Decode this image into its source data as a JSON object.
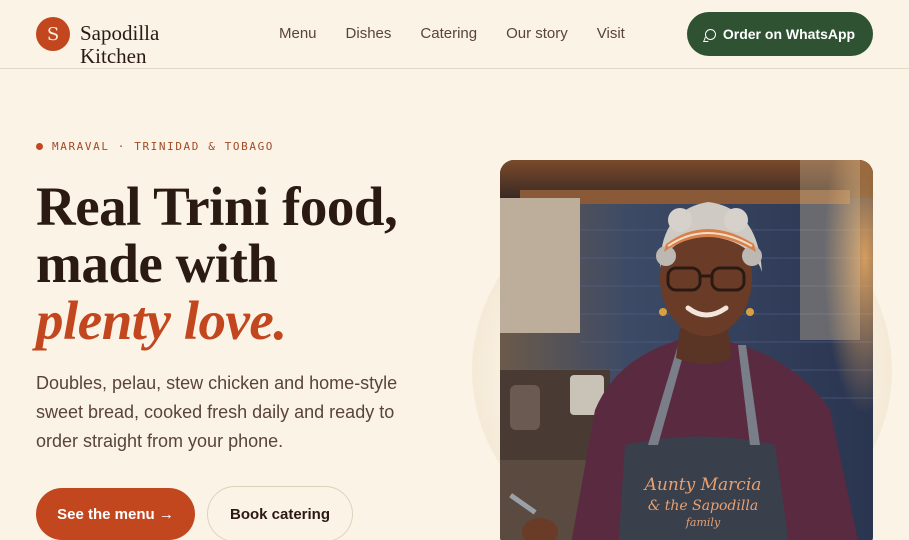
{
  "brand": {
    "initial": "S",
    "name": "Sapodilla Kitchen"
  },
  "nav": [
    {
      "label": "Menu"
    },
    {
      "label": "Dishes"
    },
    {
      "label": "Catering"
    },
    {
      "label": "Our story"
    },
    {
      "label": "Visit"
    }
  ],
  "header": {
    "order_label": "Order on WhatsApp"
  },
  "hero": {
    "eyebrow": "MARAVAL · TRINIDAD & TOBAGO",
    "headline_line1": "Real Trini food,",
    "headline_line2": "made with",
    "headline_accent": "plenty love.",
    "intro": "Doubles, pelau, stew chicken and home-style sweet bread, cooked fresh daily and ready to order straight from your phone.",
    "primary_cta": "See the menu →",
    "secondary_cta": "Book catering",
    "photo": {
      "apron_line1": "Aunty Marcia",
      "apron_line2": "& the Sapodilla",
      "apron_line3": "family"
    }
  },
  "colors": {
    "background": "#faf3e6",
    "accent": "#c2471e",
    "whatsapp_green": "#2f5233",
    "ink": "#2a1a12"
  }
}
